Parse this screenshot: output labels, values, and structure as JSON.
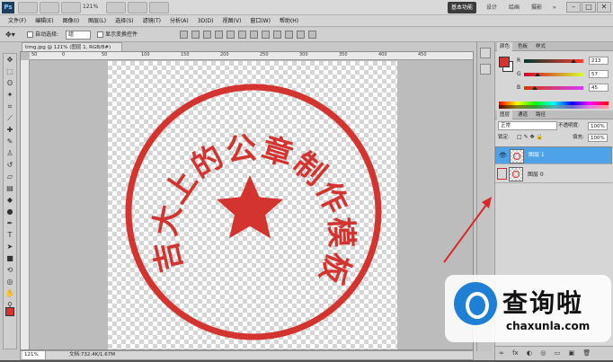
{
  "topbar": {
    "app_logo": "Ps",
    "zoom_value": "121%",
    "workspaces": [
      {
        "label": "基本功能",
        "active": true
      },
      {
        "label": "设计",
        "active": false
      },
      {
        "label": "绘画",
        "active": false
      },
      {
        "label": "摄影",
        "active": false
      }
    ],
    "more_button": "»",
    "window_buttons": [
      "–",
      "□",
      "✕"
    ]
  },
  "menubar": {
    "items": [
      "文件(F)",
      "编辑(E)",
      "图像(I)",
      "图层(L)",
      "选择(S)",
      "滤镜(T)",
      "分析(A)",
      "3D(D)",
      "视图(V)",
      "窗口(W)",
      "帮助(H)"
    ]
  },
  "options_bar": {
    "auto_select_label": "自动选择:",
    "auto_select_value": "组",
    "show_transform_label": "显示变换控件"
  },
  "document": {
    "tab_title": "timg.jpg @ 121% (图层 1, RGB/8#)",
    "ruler_ticks": [
      "50",
      "0",
      "50",
      "100",
      "150",
      "200",
      "250",
      "300",
      "350",
      "400",
      "450"
    ],
    "seal_text": "吉大上的公章制作模板",
    "seal_color": "#d4342f"
  },
  "statusbar": {
    "zoom": "121%",
    "doc_info": "文档:732.4K/1.67M"
  },
  "color_panel": {
    "tabs": [
      "颜色",
      "色板",
      "样式"
    ],
    "foreground": "#d4342f",
    "channels": [
      {
        "label": "R",
        "value": "213",
        "level": 0.84
      },
      {
        "label": "G",
        "value": "57",
        "level": 0.22
      },
      {
        "label": "B",
        "value": "45",
        "level": 0.18
      }
    ]
  },
  "layers_panel": {
    "tabs": [
      "图层",
      "通道",
      "路径"
    ],
    "blend_mode": "正常",
    "opacity_label": "不透明度:",
    "opacity_value": "100%",
    "lock_label": "锁定:",
    "fill_label": "填充:",
    "fill_value": "100%",
    "layers": [
      {
        "name": "图层 1",
        "selected": true,
        "visible": true
      },
      {
        "name": "图层 0",
        "selected": false,
        "visible": false
      }
    ],
    "bottom_icons": [
      "∞",
      "fx",
      "◐",
      "◎",
      "▭",
      "▣",
      "🗑"
    ]
  },
  "watermark": {
    "title": "查询啦",
    "url": "chaxunla.com"
  }
}
